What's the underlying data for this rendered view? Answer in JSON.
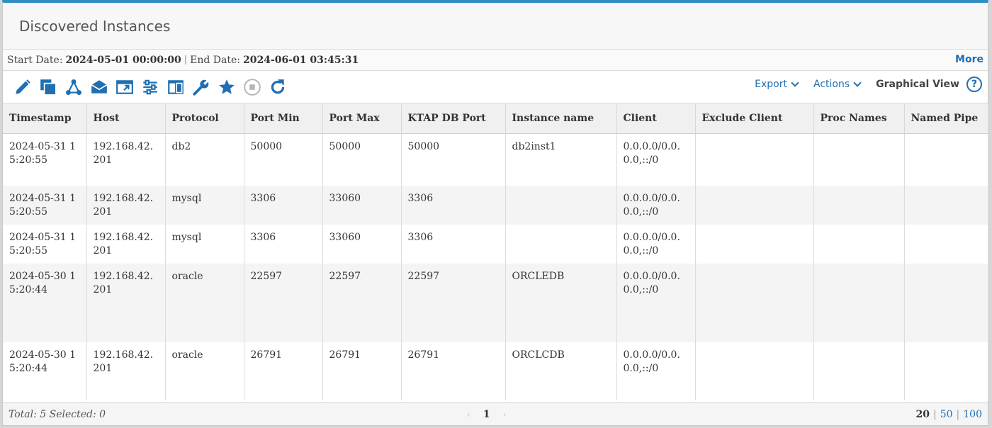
{
  "header": {
    "title": "Discovered Instances"
  },
  "date_range": {
    "start_label": "Start Date:",
    "start_value": "2024-05-01 00:00:00",
    "separator": "|",
    "end_label": "End Date:",
    "end_value": "2024-06-01 03:45:31",
    "more_label": "More"
  },
  "toolbar": {
    "icons": [
      "edit-icon",
      "copy-icon",
      "network-icon",
      "mail-icon",
      "open-window-icon",
      "settings-sliders-icon",
      "columns-icon",
      "wrench-icon",
      "star-icon",
      "stop-icon",
      "refresh-icon"
    ],
    "export_label": "Export",
    "actions_label": "Actions",
    "graphical_view_label": "Graphical View",
    "help_label": "?",
    "accent_color": "#1f6fb2"
  },
  "table": {
    "columns": [
      "Timestamp",
      "Host",
      "Protocol",
      "Port Min",
      "Port Max",
      "KTAP DB Port",
      "Instance name",
      "Client",
      "Exclude Client",
      "Proc Names",
      "Named Pipe"
    ],
    "rows": [
      [
        "2024-05-31 15:20:55",
        "192.168.42.201",
        "db2",
        "50000",
        "50000",
        "50000",
        "db2inst1",
        "0.0.0.0/0.0.0.0,::/0",
        "",
        "",
        ""
      ],
      [
        "2024-05-31 15:20:55",
        "192.168.42.201",
        "mysql",
        "3306",
        "33060",
        "3306",
        "",
        "0.0.0.0/0.0.0.0,::/0",
        "",
        "",
        ""
      ],
      [
        "2024-05-31 15:20:55",
        "192.168.42.201",
        "mysql",
        "3306",
        "33060",
        "3306",
        "",
        "0.0.0.0/0.0.0.0,::/0",
        "",
        "",
        ""
      ],
      [
        "2024-05-30 15:20:44",
        "192.168.42.201",
        "oracle",
        "22597",
        "22597",
        "22597",
        "ORCLEDB",
        "0.0.0.0/0.0.0.0,::/0",
        "",
        "",
        ""
      ],
      [
        "2024-05-30 15:20:44",
        "192.168.42.201",
        "oracle",
        "26791",
        "26791",
        "26791",
        "ORCLCDB",
        "0.0.0.0/0.0.0.0,::/0",
        "",
        "",
        ""
      ]
    ]
  },
  "footer": {
    "summary": "Total: 5 Selected: 0",
    "prev": "‹",
    "current_page": "1",
    "next": "›",
    "page_sizes": [
      "20",
      "50",
      "100"
    ],
    "active_page_size": "20"
  }
}
